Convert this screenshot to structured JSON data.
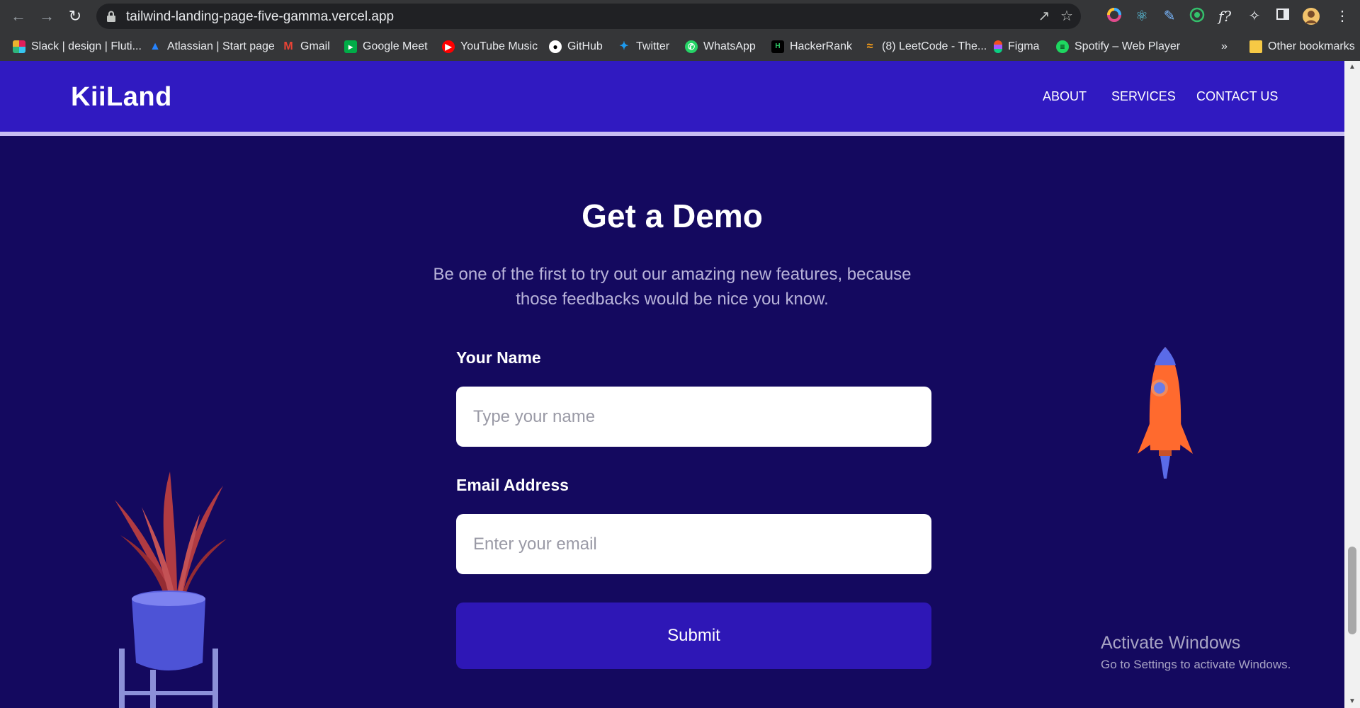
{
  "browser": {
    "url": "tailwind-landing-page-five-gamma.vercel.app",
    "bookmarks": [
      {
        "label": "Slack | design | Fluti...",
        "icon": "slack-icon"
      },
      {
        "label": "Atlassian | Start page",
        "icon": "atlassian-icon"
      },
      {
        "label": "Gmail",
        "icon": "gmail-icon"
      },
      {
        "label": "Google Meet",
        "icon": "google-meet-icon"
      },
      {
        "label": "YouTube Music",
        "icon": "youtube-music-icon"
      },
      {
        "label": "GitHub",
        "icon": "github-icon"
      },
      {
        "label": "Twitter",
        "icon": "twitter-icon"
      },
      {
        "label": "WhatsApp",
        "icon": "whatsapp-icon"
      },
      {
        "label": "HackerRank",
        "icon": "hackerrank-icon"
      },
      {
        "label": "(8) LeetCode - The...",
        "icon": "leetcode-icon"
      },
      {
        "label": "Figma",
        "icon": "figma-icon"
      },
      {
        "label": "Spotify – Web Player",
        "icon": "spotify-icon"
      }
    ],
    "overflow": "»",
    "other_bookmarks": "Other bookmarks"
  },
  "header": {
    "logo": "KiiLand",
    "nav": [
      "ABOUT",
      "SERVICES",
      "CONTACT US"
    ]
  },
  "demo": {
    "title": "Get a Demo",
    "subtitle": "Be one of the first to try out our amazing new features, because those feedbacks would be nice you know.",
    "name_label": "Your Name",
    "name_placeholder": "Type your name",
    "email_label": "Email Address",
    "email_placeholder": "Enter your email",
    "submit_label": "Submit"
  },
  "watermark": {
    "title": "Activate Windows",
    "subtitle": "Go to Settings to activate Windows."
  },
  "colors": {
    "header_bg": "#301ac1",
    "page_bg": "#14095f",
    "button_bg": "#2e17b6",
    "chrome_bg": "#353638"
  }
}
